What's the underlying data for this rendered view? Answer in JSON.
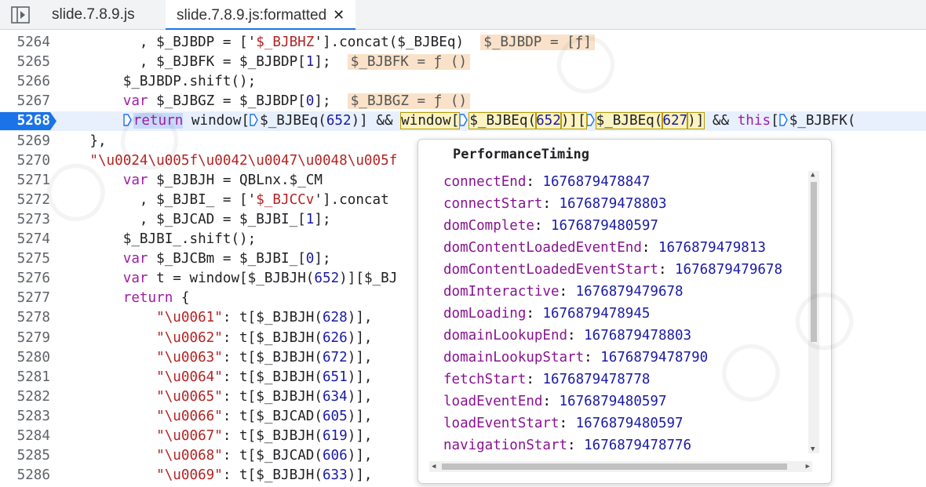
{
  "tabs": [
    {
      "label": "slide.7.8.9.js",
      "active": false
    },
    {
      "label": "slide.7.8.9.js:formatted",
      "active": true,
      "close_glyph": "✕"
    }
  ],
  "icons": {
    "navigator_toggle": "sidebar-toggle-icon",
    "tab_close": "close-icon",
    "breakpoint": "breakpoint-marker-icon",
    "step_marker": "step-into-marker-icon"
  },
  "colors": {
    "breakpoint": "#1a73e8",
    "keyword": "#a01ea0",
    "string": "#b32424",
    "number": "#1a1aa6",
    "inline_value_bg": "#f9e2c9",
    "popover_key": "#881391"
  },
  "lines": [
    {
      "n": "5264",
      "parts": [
        {
          "t": "          , $_BJBDP = ['"
        },
        {
          "t": "$_BJBHZ",
          "c": "str"
        },
        {
          "t": "'].concat($_BJBEq)  "
        },
        {
          "t": "$_BJBDP = [ƒ]",
          "c": "inl"
        }
      ]
    },
    {
      "n": "5265",
      "parts": [
        {
          "t": "          , $_BJBFK = $_BJBDP["
        },
        {
          "t": "1",
          "c": "num"
        },
        {
          "t": "];  "
        },
        {
          "t": "$_BJBFK = ƒ ()",
          "c": "inl"
        }
      ]
    },
    {
      "n": "5266",
      "parts": [
        {
          "t": "        $_BJBDP.shift();"
        }
      ]
    },
    {
      "n": "5267",
      "parts": [
        {
          "t": "        "
        },
        {
          "t": "var",
          "c": "kw"
        },
        {
          "t": " $_BJBGZ = $_BJBDP["
        },
        {
          "t": "0",
          "c": "num"
        },
        {
          "t": "];  "
        },
        {
          "t": "$_BJBGZ = ƒ ()",
          "c": "inl"
        }
      ]
    },
    {
      "n": "5268",
      "current": true,
      "parts": [
        {
          "t": "        "
        },
        {
          "t": "",
          "c": "step"
        },
        {
          "t": "return",
          "c": "kw hl"
        },
        {
          "t": " window["
        },
        {
          "t": "",
          "c": "step"
        },
        {
          "t": "$_BJBEq("
        },
        {
          "t": "652",
          "c": "num"
        },
        {
          "t": ")] && "
        },
        {
          "t": "window[",
          "c": "hl2"
        },
        {
          "t": "",
          "c": "step"
        },
        {
          "t": "$_BJBEq(",
          "c": "hl2"
        },
        {
          "t": "652",
          "c": "num hl2"
        },
        {
          "t": ")][",
          "c": "hl2"
        },
        {
          "t": "",
          "c": "step"
        },
        {
          "t": "$_BJBEq(",
          "c": "hl2"
        },
        {
          "t": "627",
          "c": "num hl2"
        },
        {
          "t": ")]",
          "c": "hl2"
        },
        {
          "t": " && "
        },
        {
          "t": "this",
          "c": "kw"
        },
        {
          "t": "["
        },
        {
          "t": "",
          "c": "step"
        },
        {
          "t": "$_BJBFK("
        }
      ]
    },
    {
      "n": "5269",
      "parts": [
        {
          "t": "    },"
        }
      ]
    },
    {
      "n": "5270",
      "parts": [
        {
          "t": "    "
        },
        {
          "t": "\"\\u0024\\u005f\\u0042\\u0047\\u0048\\u005f",
          "c": "str"
        }
      ]
    },
    {
      "n": "5271",
      "parts": [
        {
          "t": "        "
        },
        {
          "t": "var",
          "c": "kw"
        },
        {
          "t": " $_BJBJH = QBLnx.$_CM"
        }
      ]
    },
    {
      "n": "5272",
      "parts": [
        {
          "t": "          , $_BJBI_ = ['"
        },
        {
          "t": "$_BJCCv",
          "c": "str"
        },
        {
          "t": "'].concat"
        }
      ]
    },
    {
      "n": "5273",
      "parts": [
        {
          "t": "          , $_BJCAD = $_BJBI_["
        },
        {
          "t": "1",
          "c": "num"
        },
        {
          "t": "];"
        }
      ]
    },
    {
      "n": "5274",
      "parts": [
        {
          "t": "        $_BJBI_.shift();"
        }
      ]
    },
    {
      "n": "5275",
      "parts": [
        {
          "t": "        "
        },
        {
          "t": "var",
          "c": "kw"
        },
        {
          "t": " $_BJCBm = $_BJBI_["
        },
        {
          "t": "0",
          "c": "num"
        },
        {
          "t": "];"
        }
      ]
    },
    {
      "n": "5276",
      "parts": [
        {
          "t": "        "
        },
        {
          "t": "var",
          "c": "kw"
        },
        {
          "t": " t = window[$_BJBJH("
        },
        {
          "t": "652",
          "c": "num"
        },
        {
          "t": ")][$_BJ"
        }
      ]
    },
    {
      "n": "5277",
      "parts": [
        {
          "t": "        "
        },
        {
          "t": "return",
          "c": "kw"
        },
        {
          "t": " {"
        }
      ]
    },
    {
      "n": "5278",
      "parts": [
        {
          "t": "            "
        },
        {
          "t": "\"\\u0061\"",
          "c": "str"
        },
        {
          "t": ": t[$_BJBJH("
        },
        {
          "t": "628",
          "c": "num"
        },
        {
          "t": ")],"
        }
      ]
    },
    {
      "n": "5279",
      "parts": [
        {
          "t": "            "
        },
        {
          "t": "\"\\u0062\"",
          "c": "str"
        },
        {
          "t": ": t[$_BJBJH("
        },
        {
          "t": "626",
          "c": "num"
        },
        {
          "t": ")],"
        }
      ]
    },
    {
      "n": "5280",
      "parts": [
        {
          "t": "            "
        },
        {
          "t": "\"\\u0063\"",
          "c": "str"
        },
        {
          "t": ": t[$_BJBJH("
        },
        {
          "t": "672",
          "c": "num"
        },
        {
          "t": ")],"
        }
      ]
    },
    {
      "n": "5281",
      "parts": [
        {
          "t": "            "
        },
        {
          "t": "\"\\u0064\"",
          "c": "str"
        },
        {
          "t": ": t[$_BJBJH("
        },
        {
          "t": "651",
          "c": "num"
        },
        {
          "t": ")],"
        }
      ]
    },
    {
      "n": "5282",
      "parts": [
        {
          "t": "            "
        },
        {
          "t": "\"\\u0065\"",
          "c": "str"
        },
        {
          "t": ": t[$_BJBJH("
        },
        {
          "t": "634",
          "c": "num"
        },
        {
          "t": ")],"
        }
      ]
    },
    {
      "n": "5283",
      "parts": [
        {
          "t": "            "
        },
        {
          "t": "\"\\u0066\"",
          "c": "str"
        },
        {
          "t": ": t[$_BJCAD("
        },
        {
          "t": "605",
          "c": "num"
        },
        {
          "t": ")],"
        }
      ]
    },
    {
      "n": "5284",
      "parts": [
        {
          "t": "            "
        },
        {
          "t": "\"\\u0067\"",
          "c": "str"
        },
        {
          "t": ": t[$_BJBJH("
        },
        {
          "t": "619",
          "c": "num"
        },
        {
          "t": ")],"
        }
      ]
    },
    {
      "n": "5285",
      "parts": [
        {
          "t": "            "
        },
        {
          "t": "\"\\u0068\"",
          "c": "str"
        },
        {
          "t": ": t[$_BJCAD("
        },
        {
          "t": "606",
          "c": "num"
        },
        {
          "t": ")],"
        }
      ]
    },
    {
      "n": "5286",
      "parts": [
        {
          "t": "            "
        },
        {
          "t": "\"\\u0069\"",
          "c": "str"
        },
        {
          "t": ": t[$_BJBJH("
        },
        {
          "t": "633",
          "c": "num"
        },
        {
          "t": ")],"
        }
      ]
    }
  ],
  "popover": {
    "title": "PerformanceTiming",
    "properties": [
      {
        "key": "connectEnd",
        "value": "1676879478847"
      },
      {
        "key": "connectStart",
        "value": "1676879478803"
      },
      {
        "key": "domComplete",
        "value": "1676879480597"
      },
      {
        "key": "domContentLoadedEventEnd",
        "value": "1676879479813"
      },
      {
        "key": "domContentLoadedEventStart",
        "value": "1676879479678"
      },
      {
        "key": "domInteractive",
        "value": "1676879479678"
      },
      {
        "key": "domLoading",
        "value": "1676879478945"
      },
      {
        "key": "domainLookupEnd",
        "value": "1676879478803"
      },
      {
        "key": "domainLookupStart",
        "value": "1676879478790"
      },
      {
        "key": "fetchStart",
        "value": "1676879478778"
      },
      {
        "key": "loadEventEnd",
        "value": "1676879480597"
      },
      {
        "key": "loadEventStart",
        "value": "1676879480597"
      },
      {
        "key": "navigationStart",
        "value": "1676879478776"
      }
    ]
  }
}
